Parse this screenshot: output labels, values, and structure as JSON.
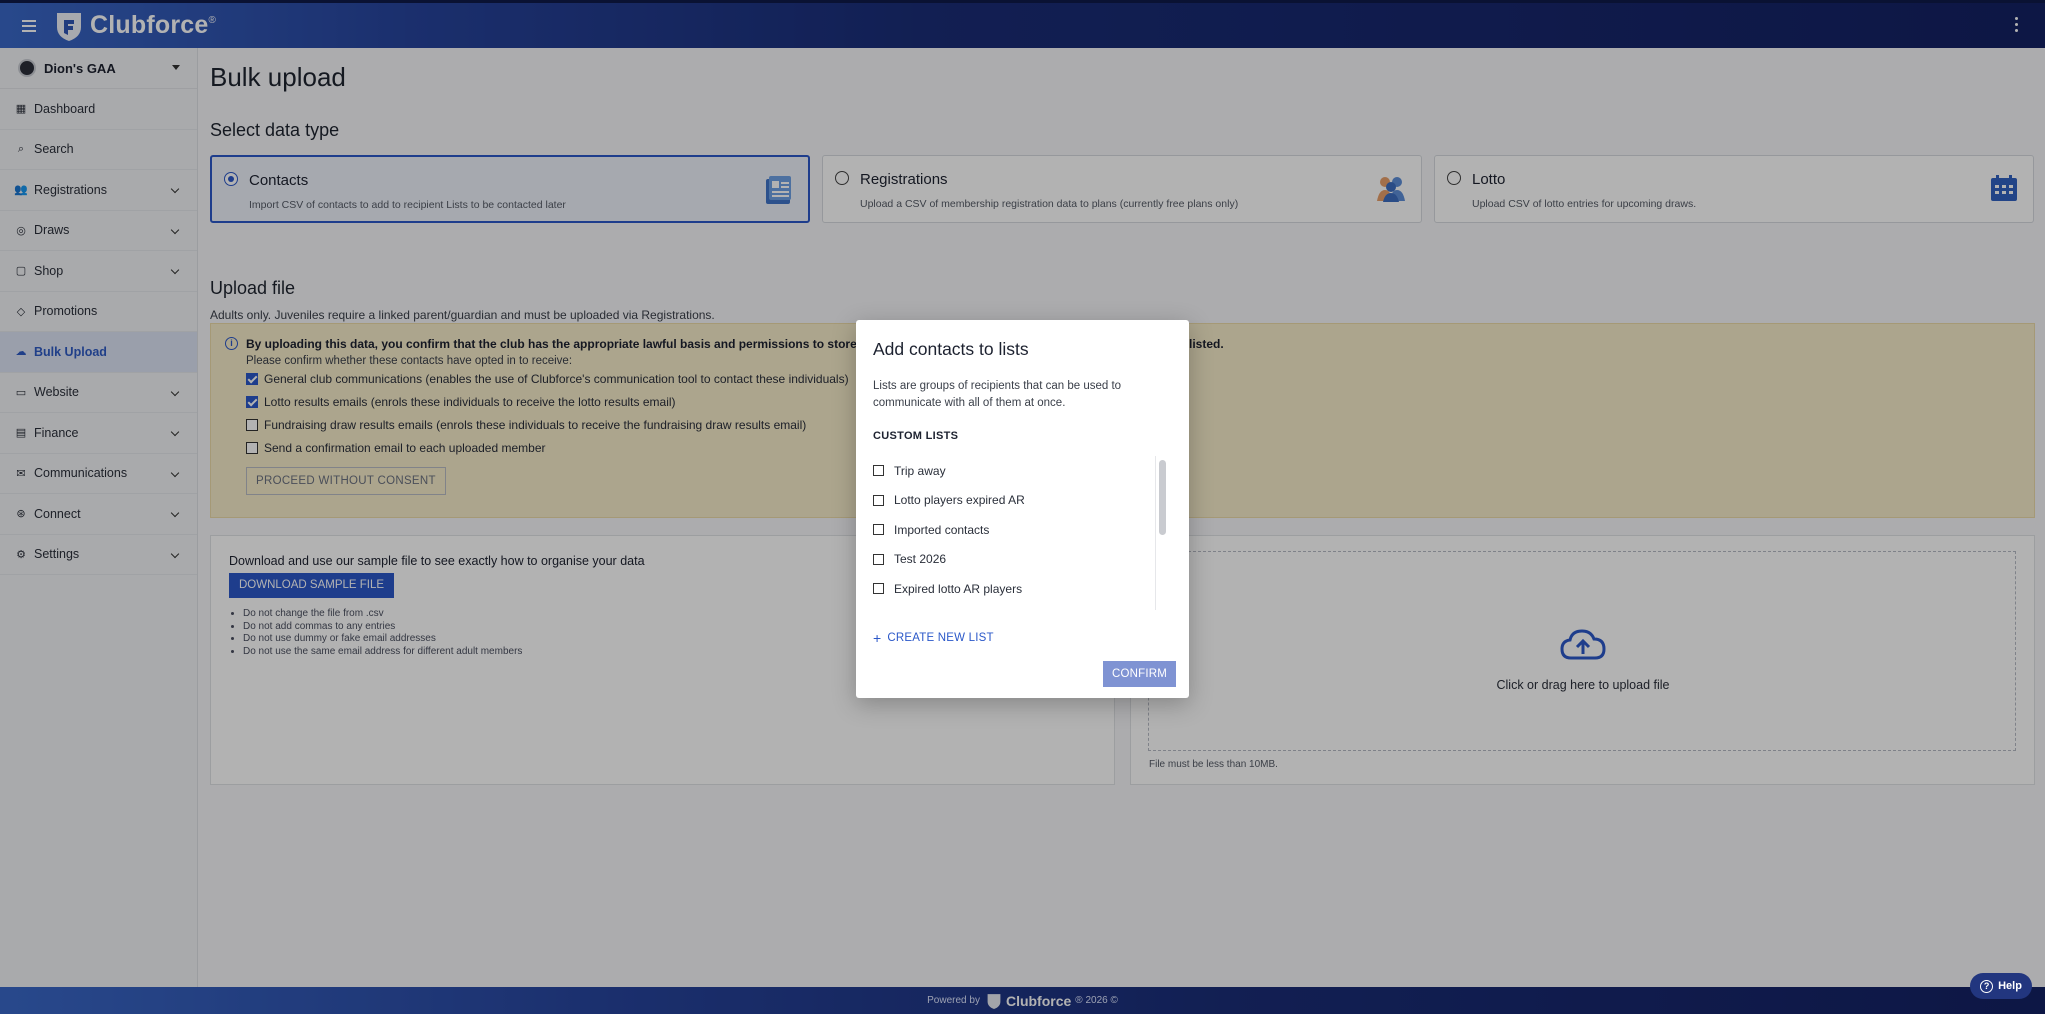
{
  "app": {
    "name": "Clubforce",
    "registered": "®"
  },
  "sidebar": {
    "club_name": "Dion's GAA",
    "items": [
      {
        "label": "Dashboard",
        "icon": "dashboard-icon",
        "expandable": false
      },
      {
        "label": "Search",
        "icon": "search-person-icon",
        "expandable": false
      },
      {
        "label": "Registrations",
        "icon": "people-icon",
        "expandable": true
      },
      {
        "label": "Draws",
        "icon": "ticket-icon",
        "expandable": true
      },
      {
        "label": "Shop",
        "icon": "bag-icon",
        "expandable": true
      },
      {
        "label": "Promotions",
        "icon": "tag-icon",
        "expandable": false
      },
      {
        "label": "Bulk Upload",
        "icon": "cloud-upload-icon",
        "expandable": false,
        "active": true
      },
      {
        "label": "Website",
        "icon": "browser-icon",
        "expandable": true
      },
      {
        "label": "Finance",
        "icon": "money-icon",
        "expandable": true
      },
      {
        "label": "Communications",
        "icon": "mail-icon",
        "expandable": true
      },
      {
        "label": "Connect",
        "icon": "connect-icon",
        "expandable": true
      },
      {
        "label": "Settings",
        "icon": "gear-icon",
        "expandable": true
      }
    ]
  },
  "main": {
    "title": "Bulk upload",
    "select_type_heading": "Select data type",
    "types": [
      {
        "title": "Contacts",
        "desc": "Import CSV of contacts to add to recipient Lists to be contacted later",
        "selected": true,
        "icon": "contacts-card-icon"
      },
      {
        "title": "Registrations",
        "desc": "Upload a CSV of membership registration data to plans (currently free plans only)",
        "selected": false,
        "icon": "people-group-icon"
      },
      {
        "title": "Lotto",
        "desc": "Upload CSV of lotto entries for upcoming draws.",
        "selected": false,
        "icon": "calendar-grid-icon"
      }
    ],
    "upload_heading": "Upload file",
    "upload_sub": "Adults only. Juveniles require a linked parent/guardian and must be uploaded via Registrations.",
    "consent": {
      "heading_left": "By uploading this data, you confirm that the club has the appropriate lawful basis and permissions to store",
      "heading_right": "listed.",
      "sub": "Please confirm whether these contacts have opted in to receive:",
      "options": [
        {
          "label": "General club communications (enables the use of Clubforce's communication tool to contact these individuals)",
          "checked": true
        },
        {
          "label": "Lotto results emails (enrols these individuals to receive the lotto results email)",
          "checked": true
        },
        {
          "label": "Fundraising draw results emails (enrols these individuals to receive the fundraising draw results email)",
          "checked": false
        },
        {
          "label": "Send a confirmation email to each uploaded member",
          "checked": false
        }
      ],
      "proceed_label": "PROCEED WITHOUT CONSENT"
    },
    "sample": {
      "text": "Download and use our sample file to see exactly how to organise your data",
      "button": "DOWNLOAD SAMPLE FILE",
      "rules": [
        "Do not change the file from .csv",
        "Do not add commas to any entries",
        "Do not use dummy or fake email addresses",
        "Do not use the same email address for different adult members"
      ]
    },
    "dropzone": {
      "text": "Click or drag here to upload file",
      "note": "File must be less than 10MB."
    }
  },
  "modal": {
    "title": "Add contacts to lists",
    "desc": "Lists are groups of recipients that can be used to communicate with all of them at once.",
    "section": "CUSTOM LISTS",
    "lists": [
      {
        "label": "Trip away",
        "checked": false
      },
      {
        "label": "Lotto players expired AR",
        "checked": false
      },
      {
        "label": "Imported contacts",
        "checked": false
      },
      {
        "label": "Test 2026",
        "checked": false
      },
      {
        "label": "Expired lotto AR players",
        "checked": false
      },
      {
        "label": "",
        "checked": false
      }
    ],
    "create_label": "CREATE NEW LIST",
    "confirm_label": "CONFIRM"
  },
  "footer": {
    "powered_by": "Powered by",
    "brand": "Clubforce",
    "year": "® 2026 ©"
  },
  "help": {
    "label": "Help"
  },
  "colors": {
    "accent": "#2b58c9",
    "banner": "#f7eccb",
    "topbar_dark": "#142163"
  }
}
